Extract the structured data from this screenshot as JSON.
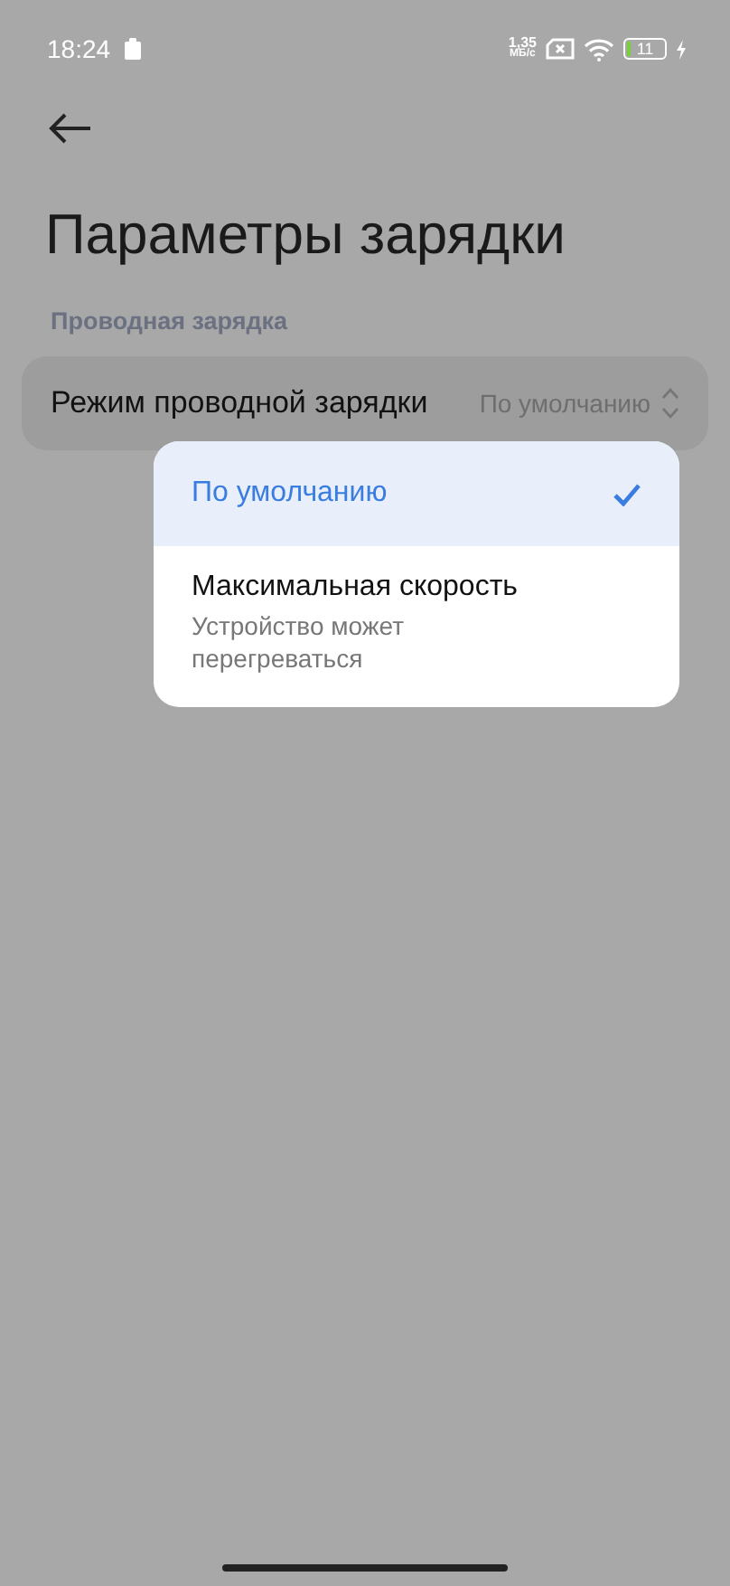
{
  "status_bar": {
    "time": "18:24",
    "net_speed": "1,35",
    "net_speed_unit": "МБ/с",
    "battery": "11"
  },
  "title": "Параметры зарядки",
  "section": "Проводная зарядка",
  "setting": {
    "label": "Режим проводной зарядки",
    "value": "По умолчанию"
  },
  "menu": [
    {
      "label": "По умолчанию",
      "selected": true
    },
    {
      "label": "Максимальная скорость",
      "description": "Устройство может перегреваться",
      "selected": false
    }
  ]
}
